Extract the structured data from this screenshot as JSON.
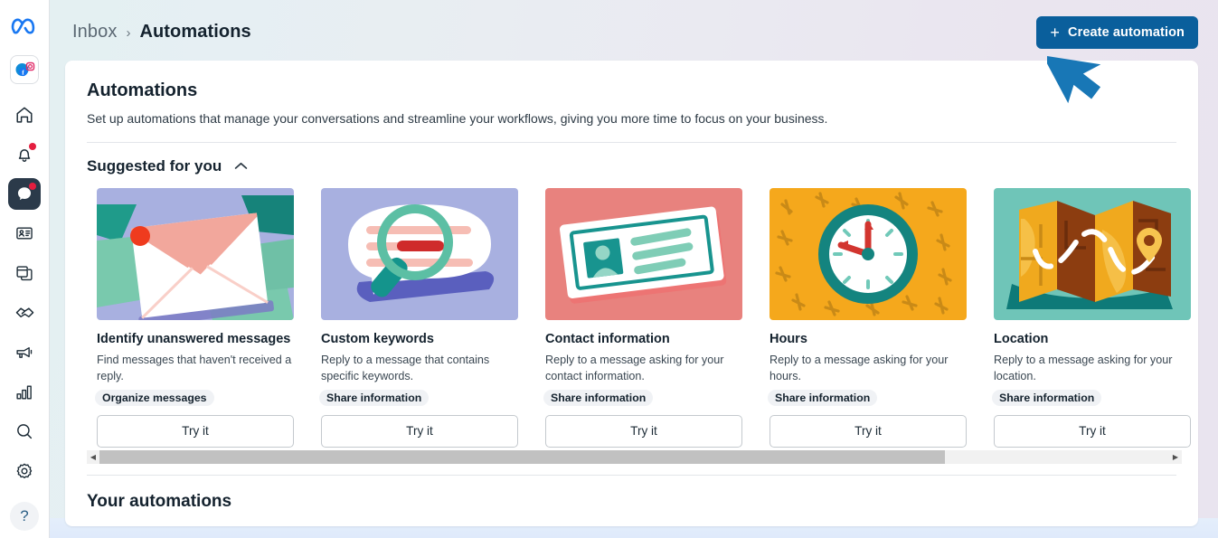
{
  "brand": {
    "logo": "meta-logo",
    "accent": "#0a5f9c",
    "selected_rail_bg": "#2b3a4a",
    "badge_color": "#e41e3f"
  },
  "rail": {
    "items": [
      {
        "name": "home-icon",
        "label": "Home",
        "badge": false
      },
      {
        "name": "bell-icon",
        "label": "Notifications",
        "badge": true
      },
      {
        "name": "chat-bubble-icon",
        "label": "Inbox",
        "badge": true,
        "selected": true
      },
      {
        "name": "contact-card-icon",
        "label": "Contacts",
        "badge": false
      },
      {
        "name": "pages-icon",
        "label": "Pages",
        "badge": false
      },
      {
        "name": "handshake-icon",
        "label": "Partnerships",
        "badge": false
      },
      {
        "name": "megaphone-icon",
        "label": "Ads",
        "badge": false
      },
      {
        "name": "bar-chart-icon",
        "label": "Insights",
        "badge": false
      },
      {
        "name": "search-icon",
        "label": "Search",
        "badge": false
      },
      {
        "name": "gear-icon",
        "label": "Settings",
        "badge": false
      }
    ],
    "help": {
      "name": "help-icon",
      "label": "?"
    }
  },
  "breadcrumb": {
    "parent": "Inbox",
    "separator": "›",
    "current": "Automations"
  },
  "toolbar": {
    "create_label": "Create automation",
    "create_plus": "+"
  },
  "page": {
    "title": "Automations",
    "subtitle": "Set up automations that manage your conversations and streamline your workflows, giving you more time to focus on your business.",
    "section_label": "Suggested for you",
    "section_chevron": "chevron-up-icon",
    "your_automations_label": "Your automations"
  },
  "cards": [
    {
      "illustration": "envelope-illustration",
      "title": "Identify unanswered messages",
      "description": "Find messages that haven't received a reply.",
      "tag": "Organize messages",
      "button": "Try it"
    },
    {
      "illustration": "magnifier-speech-bubble-illustration",
      "title": "Custom keywords",
      "description": "Reply to a message that contains specific keywords.",
      "tag": "Share information",
      "button": "Try it"
    },
    {
      "illustration": "contact-card-illustration",
      "title": "Contact information",
      "description": "Reply to a message asking for your contact information.",
      "tag": "Share information",
      "button": "Try it"
    },
    {
      "illustration": "clock-illustration",
      "title": "Hours",
      "description": "Reply to a message asking for your hours.",
      "tag": "Share information",
      "button": "Try it"
    },
    {
      "illustration": "map-illustration",
      "title": "Location",
      "description": "Reply to a message asking for your location.",
      "tag": "Share information",
      "button": "Try it"
    }
  ],
  "scrollbar": {
    "left_arrow": "◀",
    "right_arrow": "▶",
    "thumb_percent": 79
  },
  "cursor": {
    "name": "mouse-pointer-overlay",
    "color": "#1877b6"
  }
}
